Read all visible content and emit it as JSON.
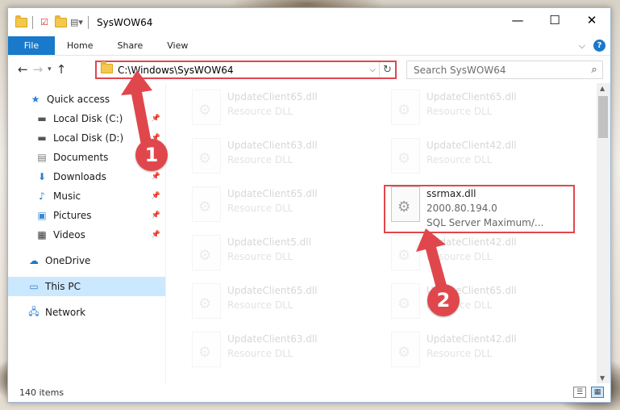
{
  "window": {
    "title": "SysWOW64",
    "controls": {
      "minimize": "—",
      "maximize": "☐",
      "close": "✕"
    }
  },
  "ribbon": {
    "tabs": [
      "File",
      "Home",
      "Share",
      "View"
    ],
    "expand_glyph": "⌵",
    "help_glyph": "?"
  },
  "address": {
    "path": "C:\\Windows\\SysWOW64",
    "search_placeholder": "Search SysWOW64"
  },
  "sidebar": {
    "items": [
      {
        "label": "Quick access",
        "icon": "star-icon",
        "pinned": false
      },
      {
        "label": "Local Disk (C:)",
        "icon": "drive-icon",
        "pinned": true
      },
      {
        "label": "Local Disk (D:)",
        "icon": "drive-icon",
        "pinned": true
      },
      {
        "label": "Documents",
        "icon": "documents-icon",
        "pinned": true
      },
      {
        "label": "Downloads",
        "icon": "downloads-icon",
        "pinned": true
      },
      {
        "label": "Music",
        "icon": "music-icon",
        "pinned": true
      },
      {
        "label": "Pictures",
        "icon": "pictures-icon",
        "pinned": true
      },
      {
        "label": "Videos",
        "icon": "videos-icon",
        "pinned": true
      },
      {
        "label": "OneDrive",
        "icon": "cloud-icon",
        "pinned": false
      },
      {
        "label": "This PC",
        "icon": "pc-icon",
        "pinned": false,
        "selected": true
      },
      {
        "label": "Network",
        "icon": "network-icon",
        "pinned": false
      }
    ]
  },
  "files": {
    "faded_sub": "Resource DLL",
    "left_col": [
      "UpdateClient65.dll",
      "UpdateClient63.dll",
      "UpdateClient65.dll",
      "UpdateClient5.dll",
      "UpdateClient65.dll",
      "UpdateClient63.dll"
    ],
    "right_col": [
      "UpdateClient65.dll",
      "UpdateClient42.dll",
      "ssrmax.dll",
      "UpdateClient42.dll",
      "UpdateClient65.dll",
      "UpdateClient42.dll"
    ],
    "highlighted": {
      "name": "ssrmax.dll",
      "version": "2000.80.194.0",
      "description": "SQL Server Maximum/..."
    }
  },
  "annotations": {
    "badge1": "1",
    "badge2": "2"
  },
  "status": {
    "item_count": "140 items"
  },
  "colors": {
    "accent": "#1979ca",
    "annotation": "#e0474c",
    "selected": "#cce8ff"
  }
}
